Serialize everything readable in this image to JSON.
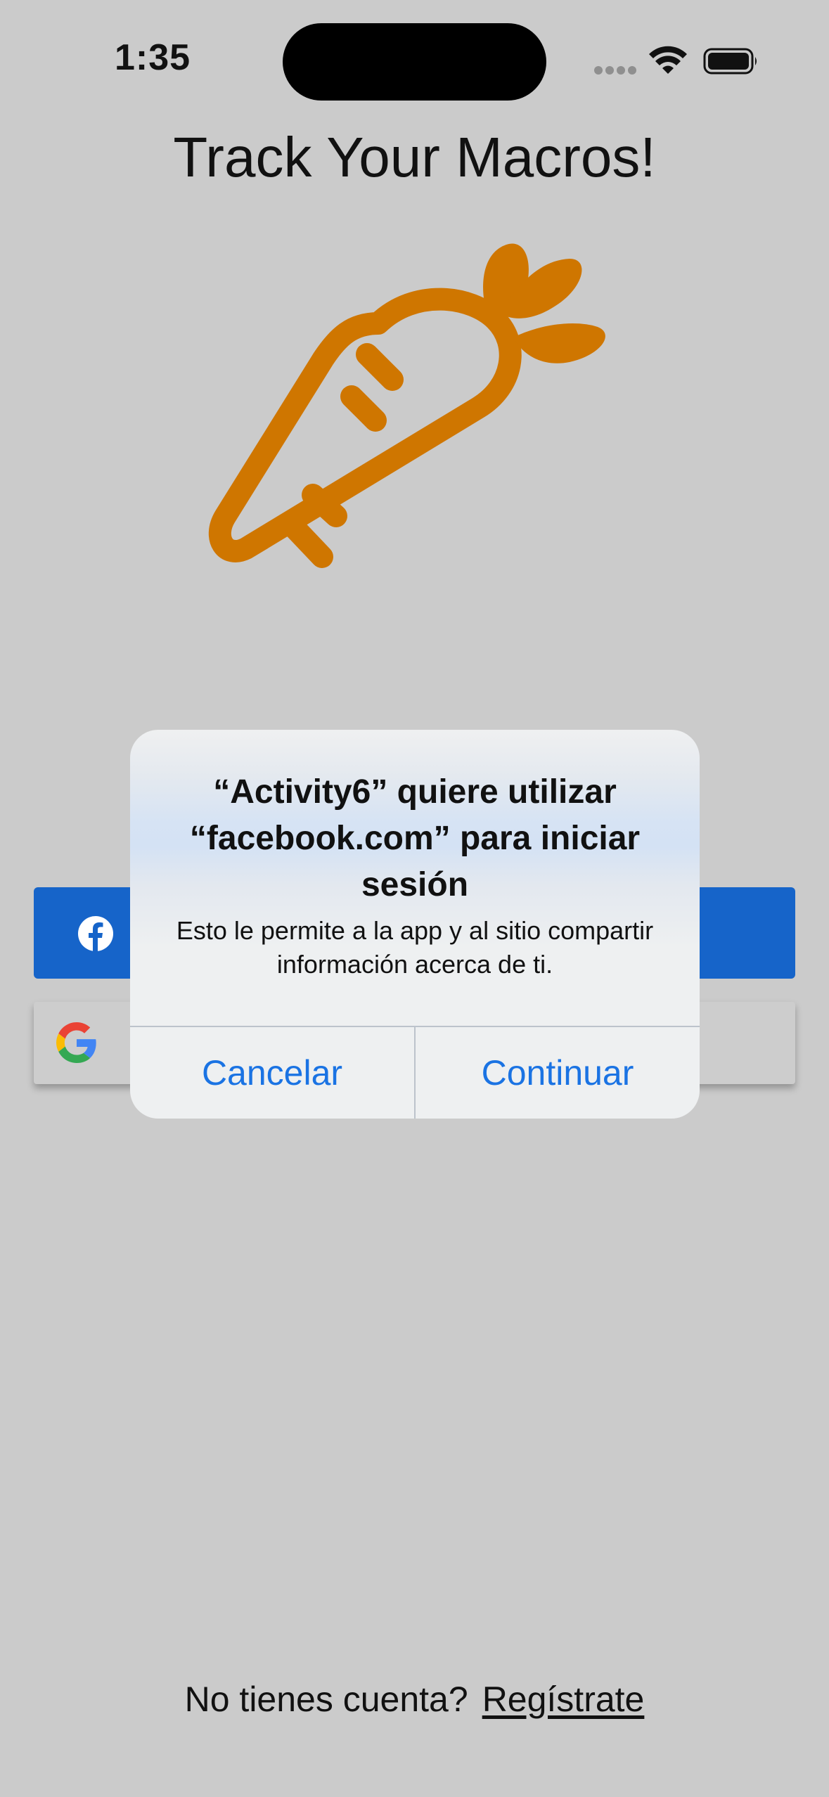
{
  "status_bar": {
    "time": "1:35"
  },
  "screen": {
    "title": "Track Your Macros!",
    "logo_icon": "carrot-icon",
    "accent_color": "#cf7600"
  },
  "buttons": {
    "facebook": {
      "icon": "facebook-icon",
      "color": "#1664c9"
    },
    "google": {
      "icon": "google-icon"
    }
  },
  "alert": {
    "title": "“Activity6” quiere utilizar “facebook.com” para iniciar sesión",
    "message": "Esto le permite a la app y al sitio compartir información acerca de ti.",
    "cancel_label": "Cancelar",
    "continue_label": "Continuar",
    "button_color": "#1a73e3"
  },
  "footer": {
    "prompt": "No tienes cuenta?",
    "link": "Regístrate"
  }
}
